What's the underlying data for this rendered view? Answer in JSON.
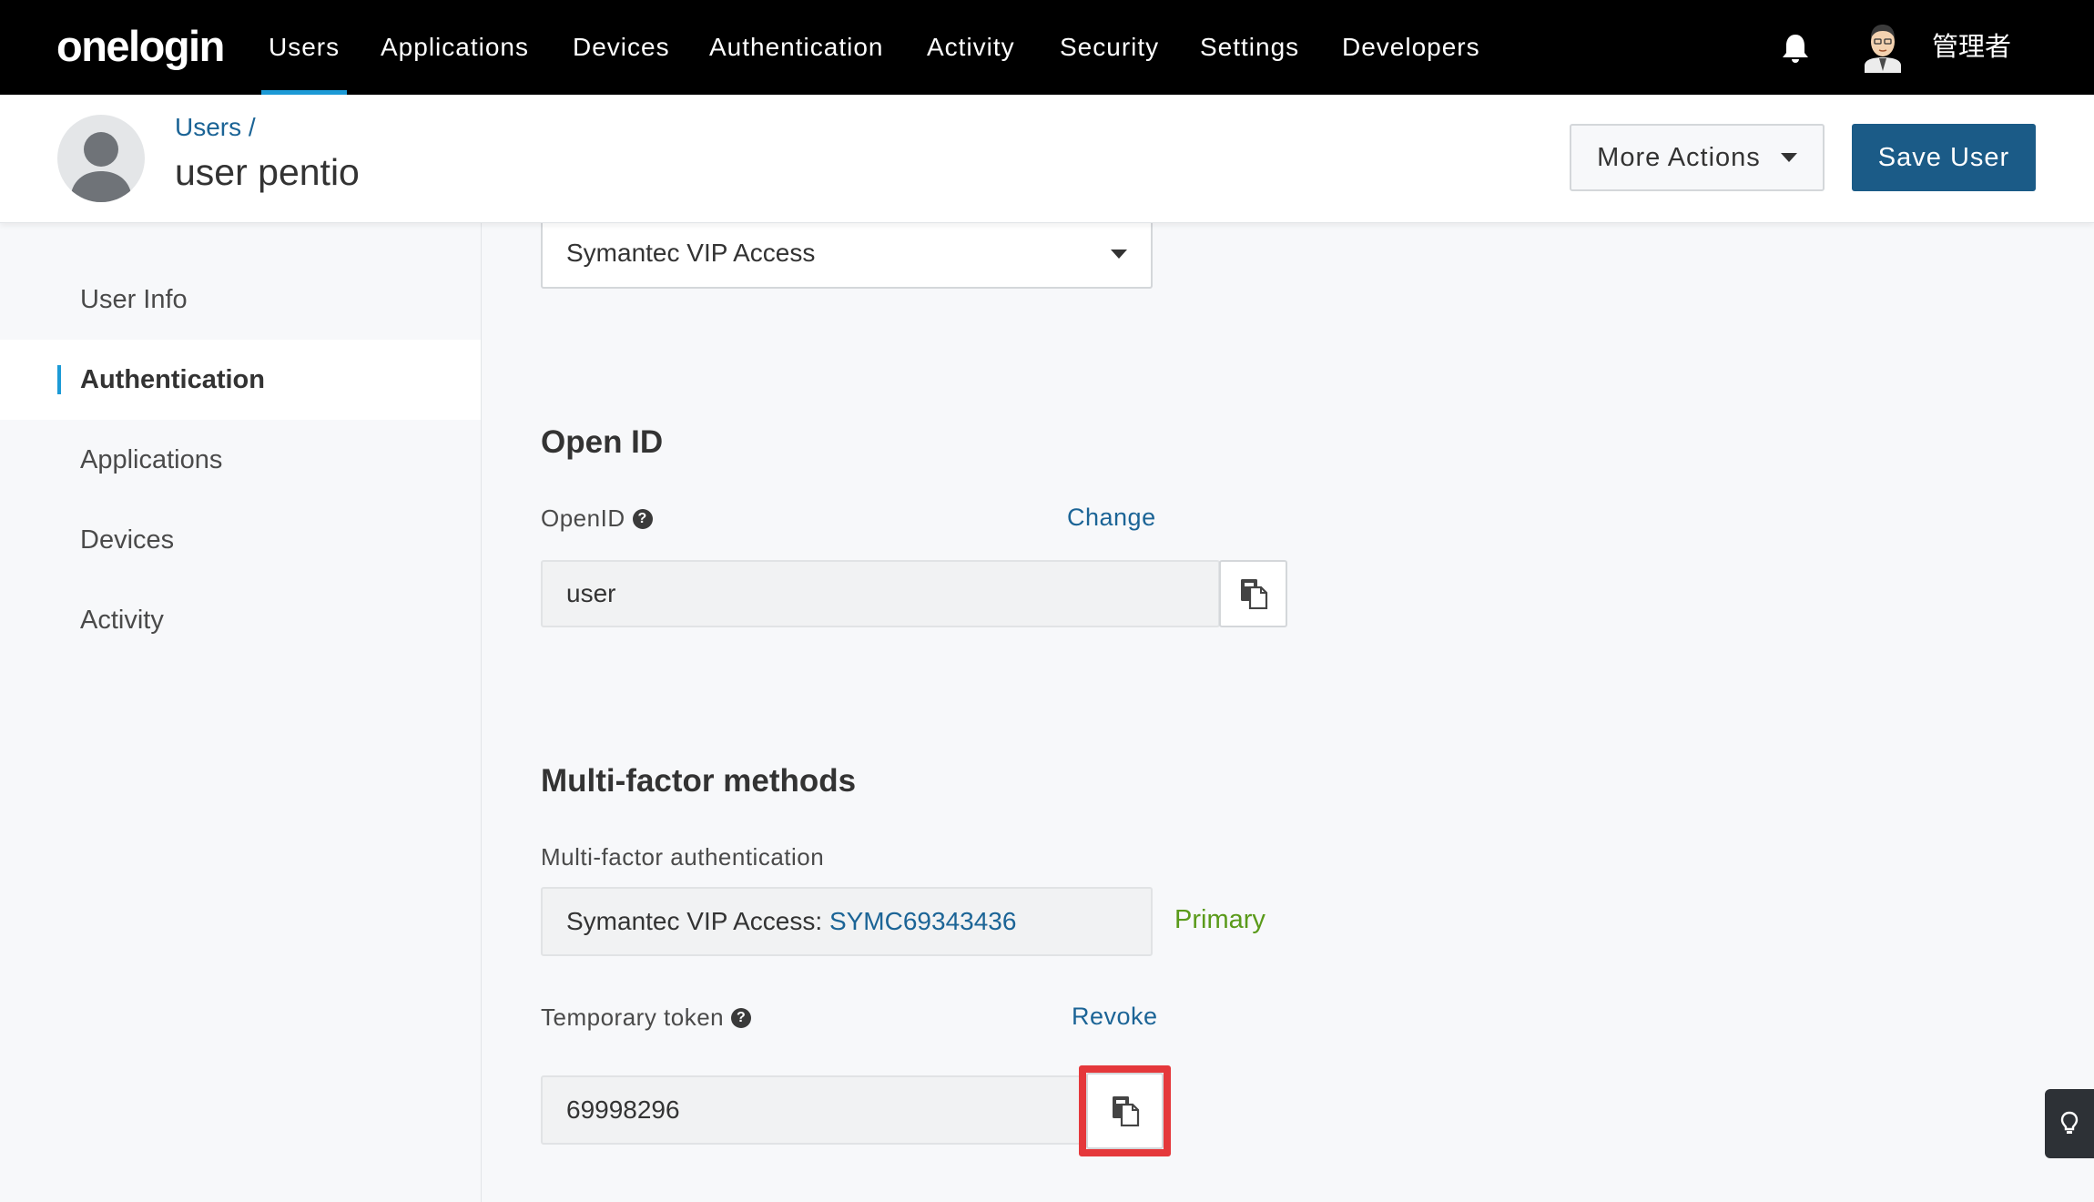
{
  "brand": {
    "logo_text": "onelogin"
  },
  "nav": {
    "items": [
      "Users",
      "Applications",
      "Devices",
      "Authentication",
      "Activity",
      "Security",
      "Settings",
      "Developers"
    ],
    "active": "Users",
    "admin_name": "管理者"
  },
  "header": {
    "breadcrumb": "Users /",
    "title": "user pentio",
    "more_actions_label": "More Actions",
    "save_label": "Save User"
  },
  "sidebar": {
    "items": [
      {
        "label": "User Info"
      },
      {
        "label": "Authentication"
      },
      {
        "label": "Applications"
      },
      {
        "label": "Devices"
      },
      {
        "label": "Activity"
      }
    ],
    "active": "Authentication"
  },
  "main": {
    "auth_select": {
      "value": "Symantec VIP Access"
    },
    "openid_section": {
      "title": "Open ID",
      "field_label": "OpenID",
      "change_label": "Change",
      "value": "user"
    },
    "mfa_section": {
      "title": "Multi-factor methods",
      "field_label": "Multi-factor authentication",
      "method_name": "Symantec VIP Access:",
      "method_id": "SYMC69343436",
      "primary_label": "Primary",
      "temp_token_label": "Temporary token",
      "revoke_label": "Revoke",
      "temp_token_value": "69998296"
    }
  },
  "icons": {
    "bell": "bell-icon",
    "help": "question-circle-icon",
    "copy": "copy-icon",
    "dropdown": "caret-down-icon",
    "tip": "lightbulb-icon"
  },
  "colors": {
    "nav_bg": "#000000",
    "nav_active": "#1c9ad6",
    "link": "#1b6496",
    "save_button": "#1b5b87",
    "primary_badge": "#5a9a1a",
    "highlight_frame": "#e5383b"
  }
}
